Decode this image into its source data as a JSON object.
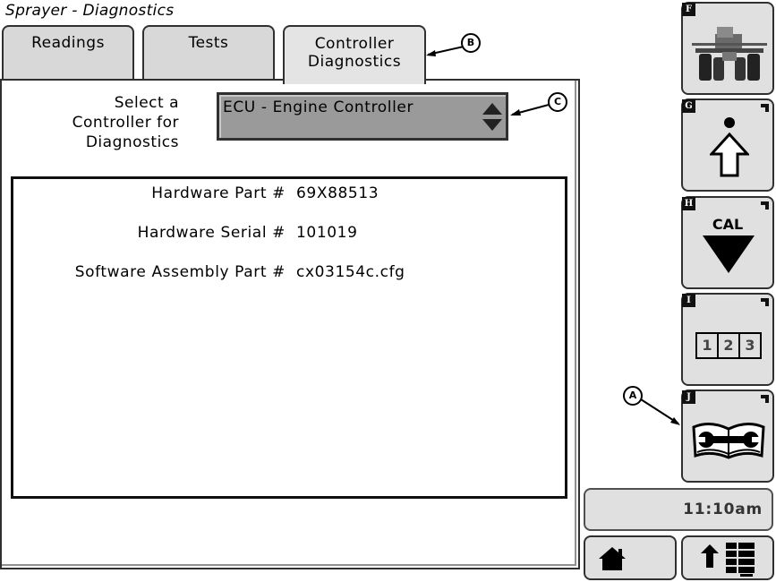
{
  "screen_title": "Sprayer - Diagnostics",
  "tabs": [
    {
      "label": "Readings"
    },
    {
      "label": "Tests"
    },
    {
      "label": "Controller\nDiagnostics",
      "line1": "Controller",
      "line2": "Diagnostics",
      "active": true
    }
  ],
  "selector": {
    "label_lines": [
      "Select a",
      "Controller for",
      "Diagnostics"
    ],
    "value": "ECU - Engine Controller"
  },
  "info": [
    {
      "label": "Hardware Part #",
      "value": "69X88513"
    },
    {
      "label": "Hardware Serial #",
      "value": "101019"
    },
    {
      "label": "Software Assembly Part #",
      "value": "cx03154c.cfg"
    }
  ],
  "side_buttons": [
    {
      "key": "F",
      "icon": "sprayer-machine-icon"
    },
    {
      "key": "G",
      "icon": "dot-up-arrow-icon"
    },
    {
      "key": "H",
      "icon": "cal-down-triangle-icon",
      "text": "CAL"
    },
    {
      "key": "I",
      "icon": "numbers-123-icon",
      "digits": [
        "1",
        "2",
        "3"
      ]
    },
    {
      "key": "J",
      "icon": "book-wrench-icon"
    }
  ],
  "clock": "11:10am",
  "bottom_buttons": [
    {
      "icon": "home-icon"
    },
    {
      "icon": "up-arrow-menu-icon"
    }
  ],
  "callouts": {
    "a": "A",
    "b": "B",
    "c": "C"
  }
}
